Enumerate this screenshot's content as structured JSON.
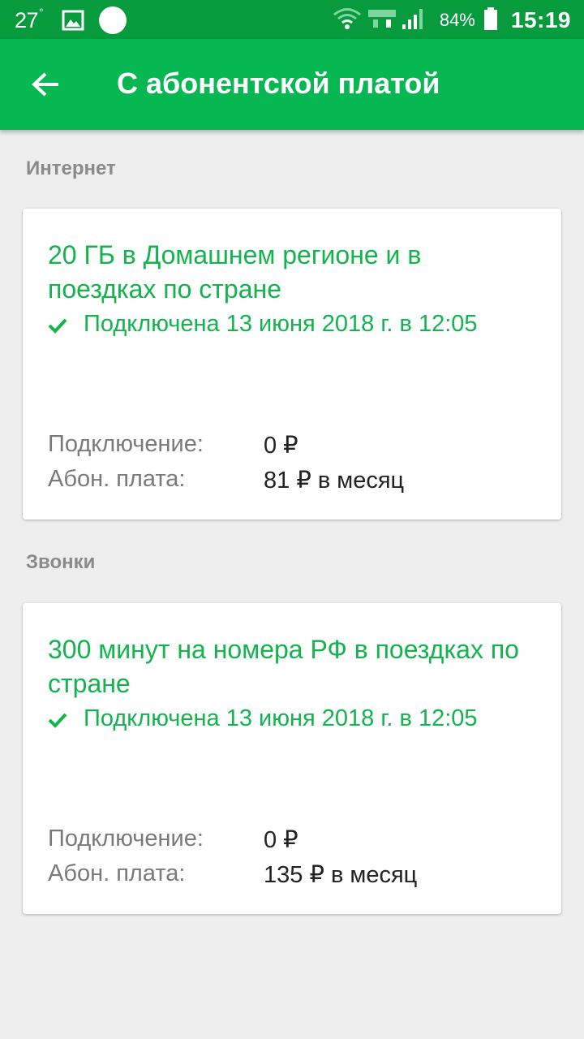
{
  "status_bar": {
    "temperature": "27",
    "degree": "°",
    "battery_percent": "84%",
    "time": "15:19",
    "icons": [
      "image-icon",
      "circle-icon",
      "wifi-icon",
      "lte-icon",
      "signal-icon",
      "battery-icon"
    ]
  },
  "app_bar": {
    "back_icon": "arrow-left-icon",
    "title": "С абонентской платой"
  },
  "colors": {
    "status_bar": "#079b3d",
    "app_bar": "#07b852",
    "accent_text": "#13b34d",
    "background": "#eeeeee"
  },
  "sections": [
    {
      "title": "Интернет",
      "card": {
        "title": "20 ГБ в Домашнем регионе и в поездках по стране",
        "status": "Подключена 13 июня 2018 г. в 12:05",
        "connection_label": "Подключение:",
        "connection_value": "0 ₽",
        "fee_label": "Абон. плата:",
        "fee_value": "81 ₽ в месяц"
      }
    },
    {
      "title": "Звонки",
      "card": {
        "title": "300 минут на номера РФ в поездках по стране",
        "status": "Подключена 13 июня 2018 г. в 12:05",
        "connection_label": "Подключение:",
        "connection_value": "0 ₽",
        "fee_label": "Абон. плата:",
        "fee_value": "135 ₽ в месяц"
      }
    }
  ]
}
